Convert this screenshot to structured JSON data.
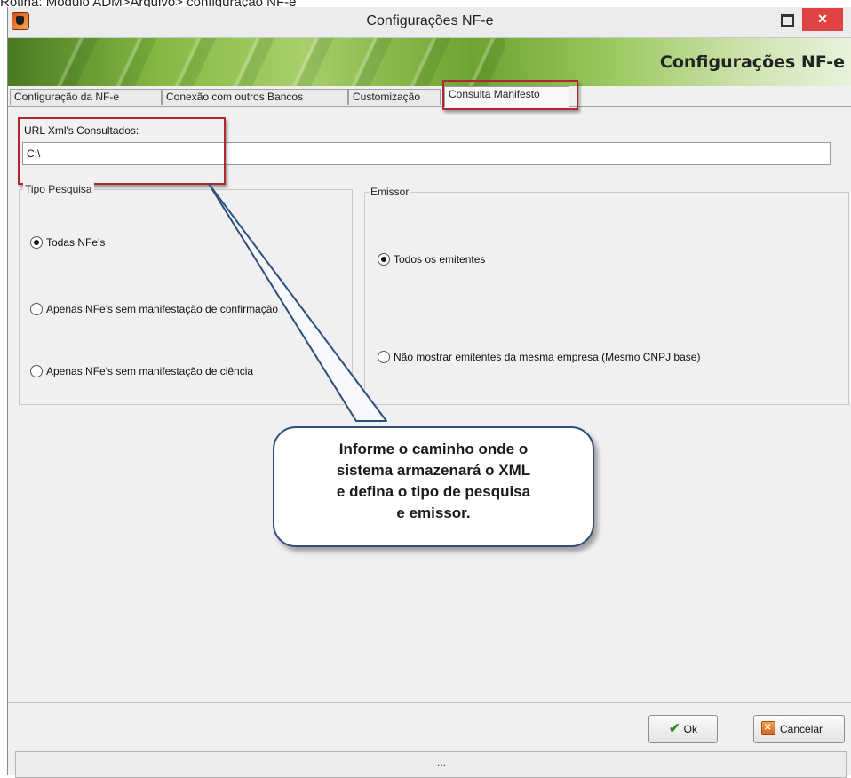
{
  "caption": "Rotina: Módulo ADM>Arquivo> configuração NF-e",
  "window": {
    "title": "Configurações NF-e",
    "controls": {
      "minimize": "–",
      "close": "✕"
    }
  },
  "banner": {
    "title": "Configurações NF-e"
  },
  "tabs": [
    {
      "label": "Configuração da NF-e"
    },
    {
      "label": "Conexão com outros Bancos"
    },
    {
      "label": "Customização"
    },
    {
      "label": "Consulta Manifesto"
    }
  ],
  "url_field": {
    "label": "URL Xml's Consultados:",
    "value": "C:\\"
  },
  "tipo_pesquisa": {
    "title": "Tipo Pesquisa",
    "options": [
      {
        "label": "Todas NFe's",
        "selected": true
      },
      {
        "label": "Apenas NFe's sem manifestação de confirmação",
        "selected": false
      },
      {
        "label": "Apenas NFe's sem manifestação de ciência",
        "selected": false
      }
    ]
  },
  "emissor": {
    "title": "Emissor",
    "options": [
      {
        "label": "Todos os emitentes",
        "selected": true
      },
      {
        "label": "Não mostrar emitentes da mesma empresa (Mesmo CNPJ base)",
        "selected": false
      }
    ]
  },
  "buttons": {
    "ok": {
      "label_first": "O",
      "label_rest": "k"
    },
    "cancel": {
      "label_first": "C",
      "label_rest": "ancelar"
    }
  },
  "status": {
    "text": "..."
  },
  "callout": {
    "lines": [
      "Informe o caminho onde o",
      "sistema armazenará o XML",
      "e defina o tipo de pesquisa",
      "e emissor."
    ]
  },
  "colors": {
    "highlight_border": "#b3262d",
    "callout_border": "#2e4f7a",
    "close_button": "#e04343"
  }
}
